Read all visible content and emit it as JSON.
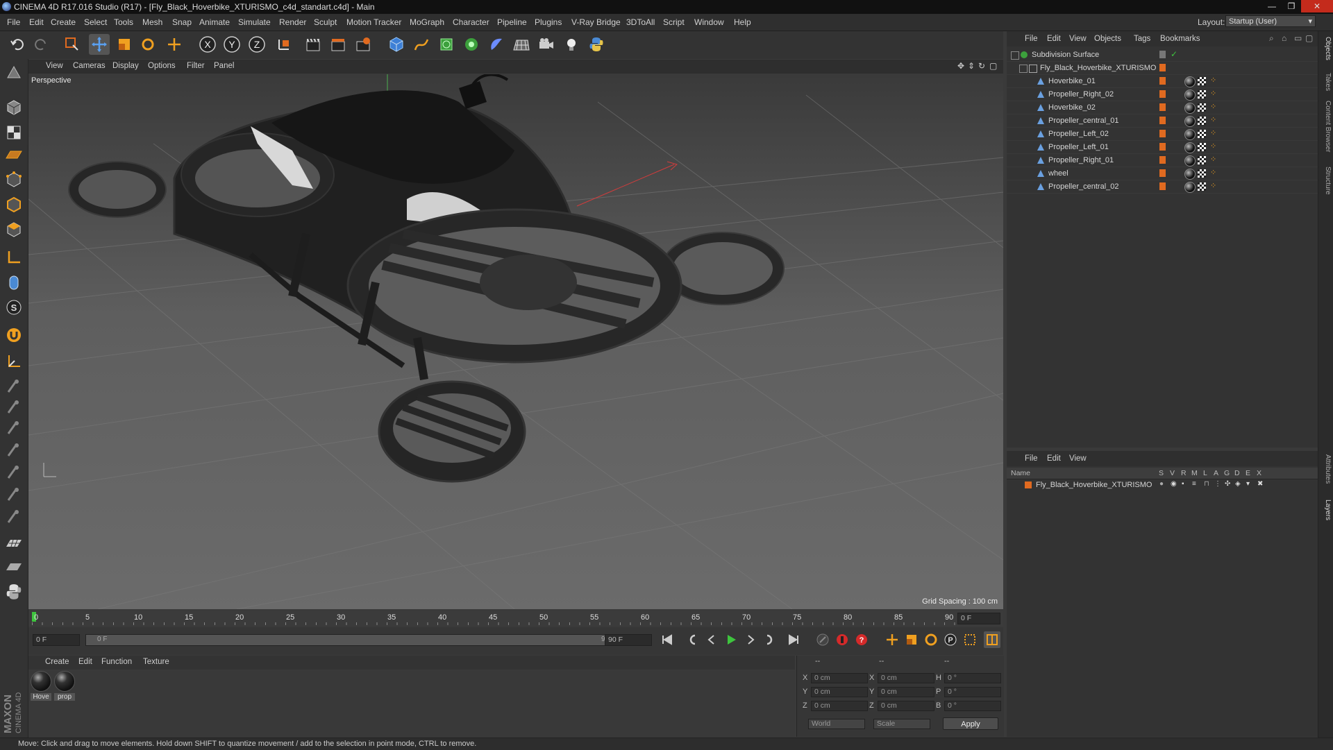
{
  "window": {
    "title": "CINEMA 4D R17.016 Studio (R17) - [Fly_Black_Hoverbike_XTURISMO_c4d_standart.c4d] - Main",
    "minimize": "—",
    "maximize": "❐",
    "close": "✕"
  },
  "menubar": {
    "items": [
      "File",
      "Edit",
      "Create",
      "Select",
      "Tools",
      "Mesh",
      "Snap",
      "Animate",
      "Simulate",
      "Render",
      "Sculpt",
      "Motion Tracker",
      "MoGraph",
      "Character",
      "Pipeline",
      "Plugins",
      "V-Ray Bridge",
      "3DToAll",
      "Script",
      "Window",
      "Help"
    ],
    "layout_label": "Layout:",
    "layout_value": "Startup (User)"
  },
  "viewport": {
    "menu": [
      "View",
      "Cameras",
      "Display",
      "Options",
      "Filter",
      "Panel"
    ],
    "label": "Perspective",
    "grid_spacing": "Grid Spacing : 100 cm"
  },
  "timeline": {
    "ticks": [
      "0",
      "5",
      "10",
      "15",
      "20",
      "25",
      "30",
      "35",
      "40",
      "45",
      "50",
      "55",
      "60",
      "65",
      "70",
      "75",
      "80",
      "85",
      "90"
    ],
    "current_frame": "0 F",
    "start_field": "0 F",
    "range_start": "0 F",
    "range_end": "90 F",
    "end_field": "90 F"
  },
  "materials": {
    "menu": [
      "Create",
      "Edit",
      "Function",
      "Texture"
    ],
    "items": [
      {
        "label": "Hove"
      },
      {
        "label": "prop"
      }
    ]
  },
  "coordinates": {
    "headers": [
      "--",
      "--",
      "--"
    ],
    "rows": [
      {
        "l1": "X",
        "v1": "0 cm",
        "l2": "X",
        "v2": "0 cm",
        "l3": "H",
        "v3": "0 °"
      },
      {
        "l1": "Y",
        "v1": "0 cm",
        "l2": "Y",
        "v2": "0 cm",
        "l3": "P",
        "v3": "0 °"
      },
      {
        "l1": "Z",
        "v1": "0 cm",
        "l2": "Z",
        "v2": "0 cm",
        "l3": "B",
        "v3": "0 °"
      }
    ],
    "world": "World",
    "scale": "Scale",
    "apply": "Apply"
  },
  "status": "Move: Click and drag to move elements. Hold down SHIFT to quantize movement / add to the selection in point mode, CTRL to remove.",
  "object_manager": {
    "menu": [
      "File",
      "Edit",
      "View",
      "Objects",
      "Tags",
      "Bookmarks"
    ],
    "objects": [
      {
        "name": "Subdivision Surface",
        "level": 0,
        "type": "subdiv"
      },
      {
        "name": "Fly_Black_Hoverbike_XTURISMO",
        "level": 1,
        "type": "null"
      },
      {
        "name": "Hoverbike_01",
        "level": 2,
        "type": "poly"
      },
      {
        "name": "Propeller_Right_02",
        "level": 2,
        "type": "poly"
      },
      {
        "name": "Hoverbike_02",
        "level": 2,
        "type": "poly"
      },
      {
        "name": "Propeller_central_01",
        "level": 2,
        "type": "poly"
      },
      {
        "name": "Propeller_Left_02",
        "level": 2,
        "type": "poly"
      },
      {
        "name": "Propeller_Left_01",
        "level": 2,
        "type": "poly"
      },
      {
        "name": "Propeller_Right_01",
        "level": 2,
        "type": "poly"
      },
      {
        "name": "wheel",
        "level": 2,
        "type": "poly"
      },
      {
        "name": "Propeller_central_02",
        "level": 2,
        "type": "poly"
      }
    ]
  },
  "layer_manager": {
    "menu": [
      "File",
      "Edit",
      "View"
    ],
    "columns": [
      "Name",
      "S",
      "V",
      "R",
      "M",
      "L",
      "A",
      "G",
      "D",
      "E",
      "X"
    ],
    "layers": [
      {
        "name": "Fly_Black_Hoverbike_XTURISMO",
        "color": "#e06a20"
      }
    ]
  },
  "side_tabs": [
    "Objects",
    "Takes",
    "Content Browser",
    "Structure",
    "Attributes",
    "Layers"
  ],
  "colors": {
    "accent_blue": "#3d7fd6",
    "layer_orange": "#e06a20",
    "play_green": "#3ec43e",
    "record_red": "#d42a2a"
  }
}
